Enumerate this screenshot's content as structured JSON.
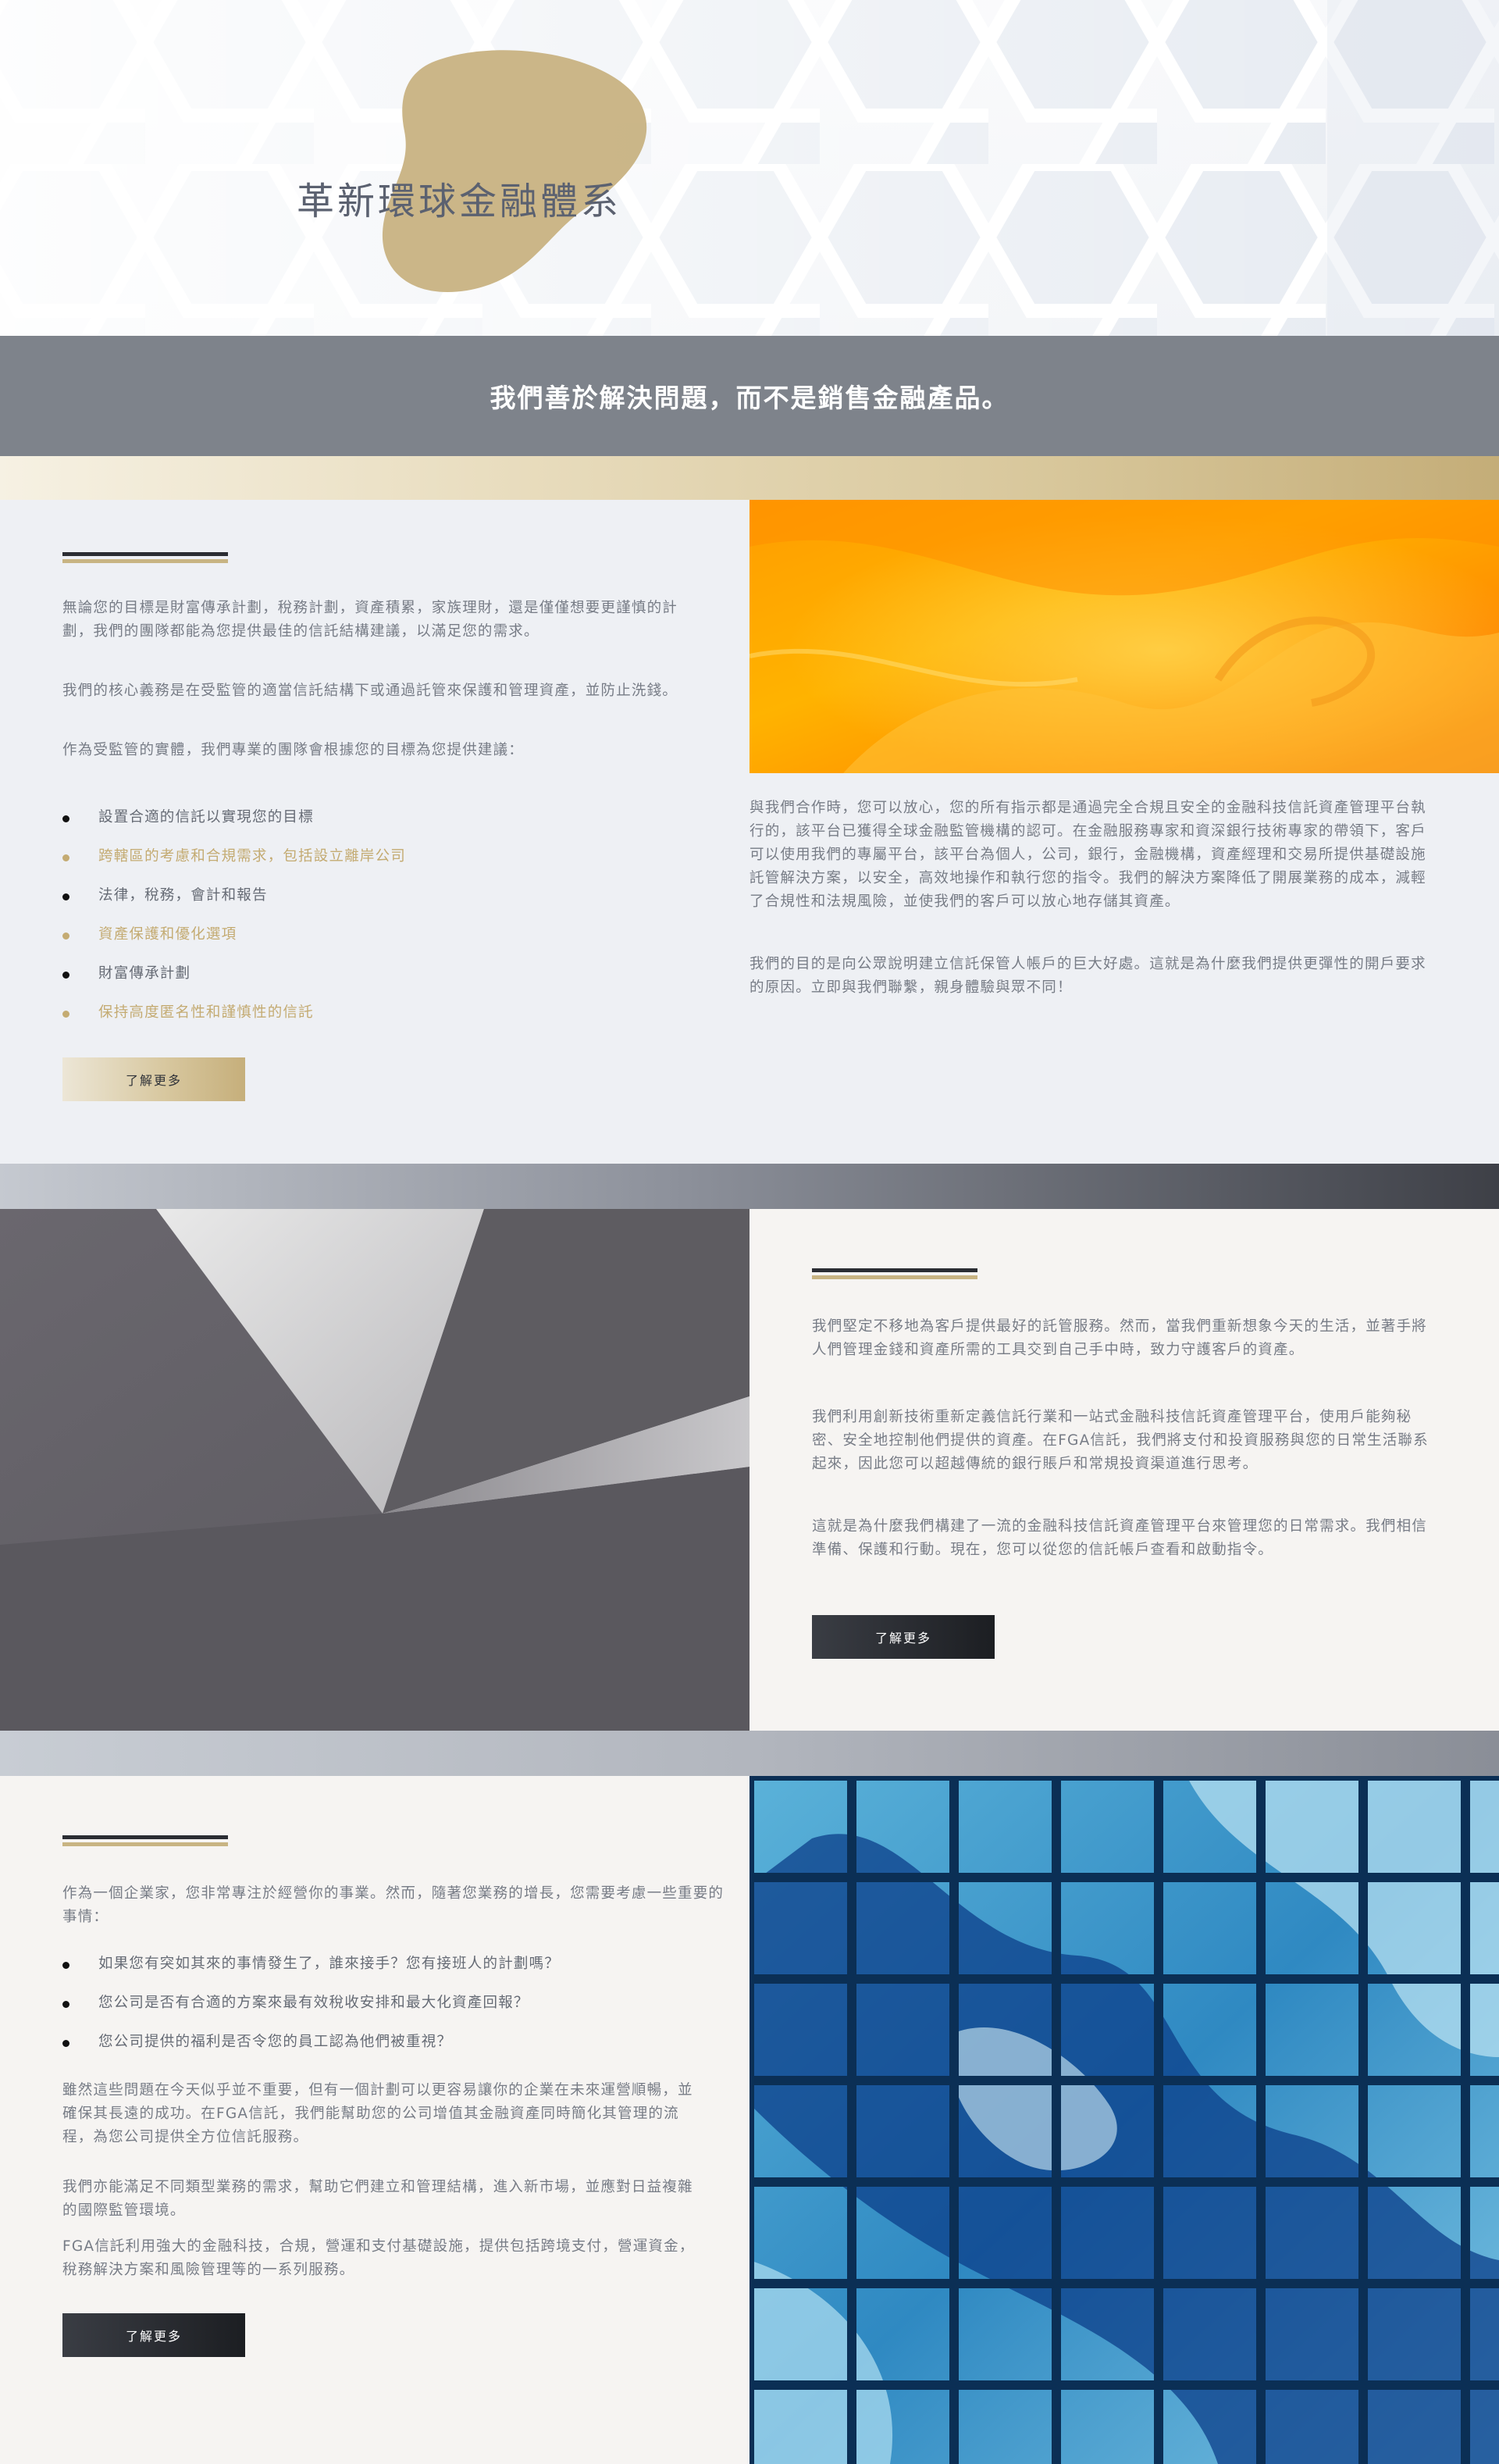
{
  "hero": {
    "title": "革新環球金融體系"
  },
  "tagline": "我們善於解決問題，而不是銷售金融產品。",
  "section1": {
    "paragraphs": [
      "無論您的目標是財富傳承計劃，稅務計劃，資產積累，家族理財，還是僅僅想要更謹慎的計劃，我們的團隊都能為您提供最佳的信託結構建議，以滿足您的需求。",
      "我們的核心義務是在受監管的適當信託結構下或通過託管來保護和管理資產，並防止洗錢。",
      "作為受監管的實體，我們專業的團隊會根據您的目標為您提供建議："
    ],
    "bullets": [
      "設置合適的信託以實現您的目標",
      "跨轄區的考慮和合規需求，包括設立離岸公司",
      "法律，稅務，會計和報告",
      "資產保護和優化選項",
      "財富傳承計劃",
      "保持高度匿名性和謹慎性的信託"
    ],
    "button_label": "了解更多",
    "right_paragraphs": [
      "與我們合作時，您可以放心，您的所有指示都是通過完全合規且安全的金融科技信託資產管理平台執行的，該平台已獲得全球金融監管機構的認可。在金融服務專家和資深銀行技術專家的帶領下，客戶可以使用我們的專屬平台，該平台為個人，公司，銀行，金融機構，資產經理和交易所提供基礎設施託管解決方案，以安全，高效地操作和執行您的指令。我們的解決方案降低了開展業務的成本，減輕了合規性和法規風險，並使我們的客戶可以放心地存儲其資產。",
      "我們的目的是向公眾說明建立信託保管人帳戶的巨大好處。這就是為什麼我們提供更彈性的開戶要求的原因。立即與我們聯繫，親身體驗與眾不同！"
    ]
  },
  "section2": {
    "paragraphs": [
      "我們堅定不移地為客戶提供最好的託管服務。然而，當我們重新想象今天的生活，並著手將人們管理金錢和資產所需的工具交到自己手中時，致力守護客戶的資產。",
      "我們利用創新技術重新定義信託行業和一站式金融科技信託資產管理平台，使用戶能夠秘密、安全地控制他們提供的資產。在FGA信託，我們將支付和投資服務與您的日常生活聯系起來，因此您可以超越傳統的銀行賬戶和常規投資渠道進行思考。",
      "這就是為什麼我們構建了一流的金融科技信託資產管理平台來管理您的日常需求。我們相信準備、保護和行動。現在，您可以從您的信託帳戶查看和啟動指令。"
    ],
    "button_label": "了解更多"
  },
  "section3": {
    "intro": "作為一個企業家，您非常專注於經營你的事業。然而，隨著您業務的增長，您需要考慮一些重要的事情：",
    "bullets": [
      "如果您有突如其來的事情發生了，誰來接手？您有接班人的計劃嗎？",
      "您公司是否有合適的方案來最有效稅收安排和最大化資產回報？",
      "您公司提供的福利是否令您的員工認為他們被重視？"
    ],
    "paragraphs": [
      "雖然這些問題在今天似乎並不重要，但有一個計劃可以更容易讓你的企業在未來運營順暢，並確保其長遠的成功。在FGA信託，我們能幫助您的公司增值其金融資產同時簡化其管理的流程，為您公司提供全方位信託服務。",
      "我們亦能滿足不同類型業務的需求，幫助它們建立和管理結構，進入新市場，並應對日益複雜的國際監管環境。",
      "FGA信託利用強大的金融科技，合規，營運和支付基礎設施，提供包括跨境支付，營運資金，稅務解決方案和風險管理等的一系列服務。"
    ],
    "button_label": "了解更多"
  }
}
